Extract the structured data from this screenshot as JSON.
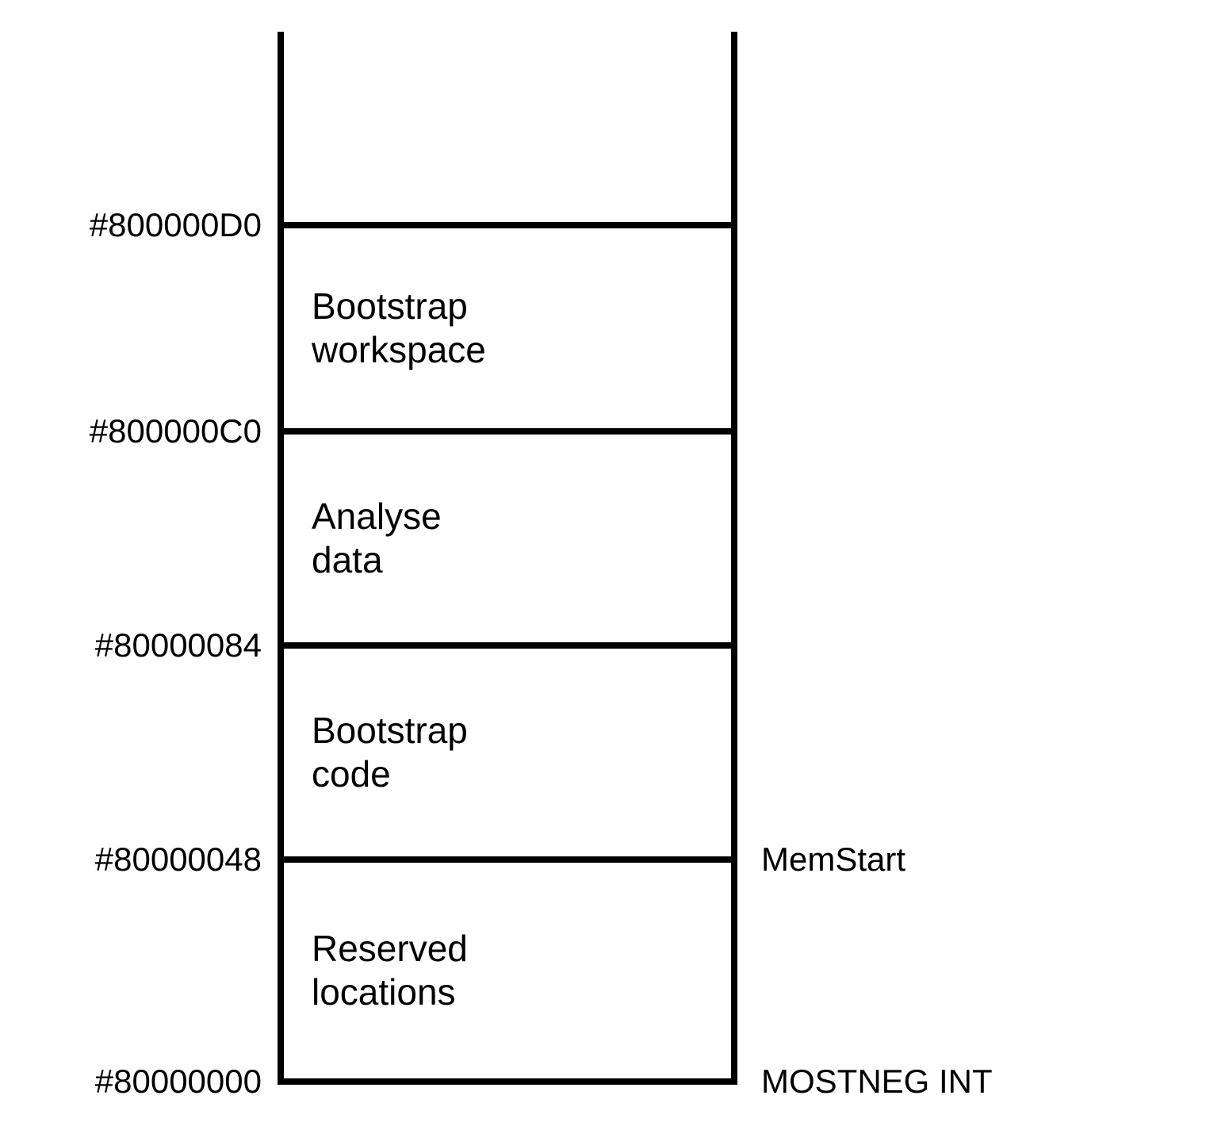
{
  "addresses": {
    "addr0": "#800000D0",
    "addr1": "#800000C0",
    "addr2": "#80000084",
    "addr3": "#80000048",
    "addr4": "#80000000"
  },
  "regions": {
    "region0": "",
    "region1_line1": "Bootstrap",
    "region1_line2": "workspace",
    "region2_line1": "Analyse",
    "region2_line2": "data",
    "region3_line1": "Bootstrap",
    "region3_line2": "code",
    "region4_line1": "Reserved",
    "region4_line2": "locations"
  },
  "right_labels": {
    "memstart": "MemStart",
    "mostneg": "MOSTNEG INT"
  }
}
